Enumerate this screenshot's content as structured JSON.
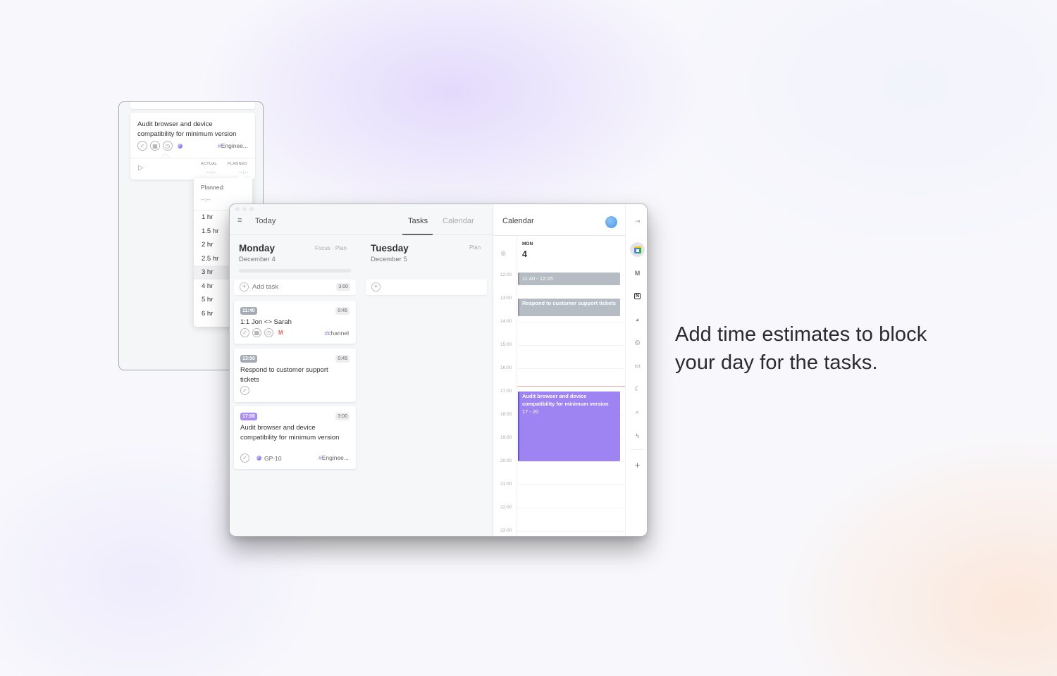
{
  "headline": "Add time estimates to block your day for the tasks.",
  "popup": {
    "card": {
      "title": "Audit browser and device compatibility for minimum version",
      "tag": "Enginee...",
      "actual_label": "ACTUAL",
      "actual_value": "--:--",
      "planned_label": "PLANNED",
      "planned_value": "--:--"
    },
    "dropdown": {
      "label": "Planned:",
      "value": "--:--",
      "options": [
        "1 hr",
        "1.5 hr",
        "2 hr",
        "2.5 hr",
        "3 hr",
        "4 hr",
        "5 hr",
        "6 hr"
      ],
      "highlighted": "3 hr"
    }
  },
  "app": {
    "header": {
      "title": "Today",
      "tabs": [
        {
          "label": "Tasks",
          "active": true
        },
        {
          "label": "Calendar",
          "active": false
        }
      ]
    },
    "days": [
      {
        "name": "Monday",
        "date": "December 4",
        "links": "Focus · Plan",
        "add_task": {
          "label": "Add task",
          "duration": "3:00"
        },
        "tasks": [
          {
            "time": "11:40",
            "time_color": "#a3abb4",
            "duration": "0:45",
            "title": "1:1 Jon <> Sarah",
            "tag": "channel",
            "source": "gmail"
          },
          {
            "time": "13:00",
            "time_color": "#a3abb4",
            "duration": "0:45",
            "title": "Respond to customer support tickets"
          },
          {
            "time": "17:00",
            "time_color": "#a98df3",
            "duration": "3:00",
            "title": "Audit browser and device compatibility for minimum version",
            "project": "GP-10",
            "tag": "Enginee..."
          }
        ]
      },
      {
        "name": "Tuesday",
        "date": "December 5",
        "links": "Plan",
        "add_task": {
          "label": ""
        }
      }
    ],
    "calendar": {
      "title": "Calendar",
      "day_of_week": "MON",
      "day_number": "4",
      "hours": [
        "12:00",
        "13:00",
        "14:00",
        "15:00",
        "16:00",
        "17:00",
        "18:00",
        "19:00",
        "20:00",
        "21:00",
        "22:00",
        "23:00"
      ],
      "current_time": "16:45",
      "events": [
        {
          "title": "1:1 Jon <> Sarah",
          "time": "11:40 - 12:25",
          "start": 11.667,
          "end": 12.417,
          "color": "gray"
        },
        {
          "title": "Respond to customer support tickets",
          "time": "",
          "start": 13.0,
          "end": 13.75,
          "color": "gray"
        },
        {
          "title": "Audit browser and device compatibility for minimum version",
          "time": "17 - 20",
          "start": 17.0,
          "end": 20.0,
          "color": "purple"
        }
      ]
    },
    "rail": {
      "items": [
        "collapse-icon",
        "google-calendar-icon",
        "gmail-icon",
        "notion-icon",
        "linear-icon",
        "target-icon",
        "archive-icon",
        "moon-icon",
        "search-icon",
        "zap-icon",
        "plus-icon"
      ]
    }
  }
}
